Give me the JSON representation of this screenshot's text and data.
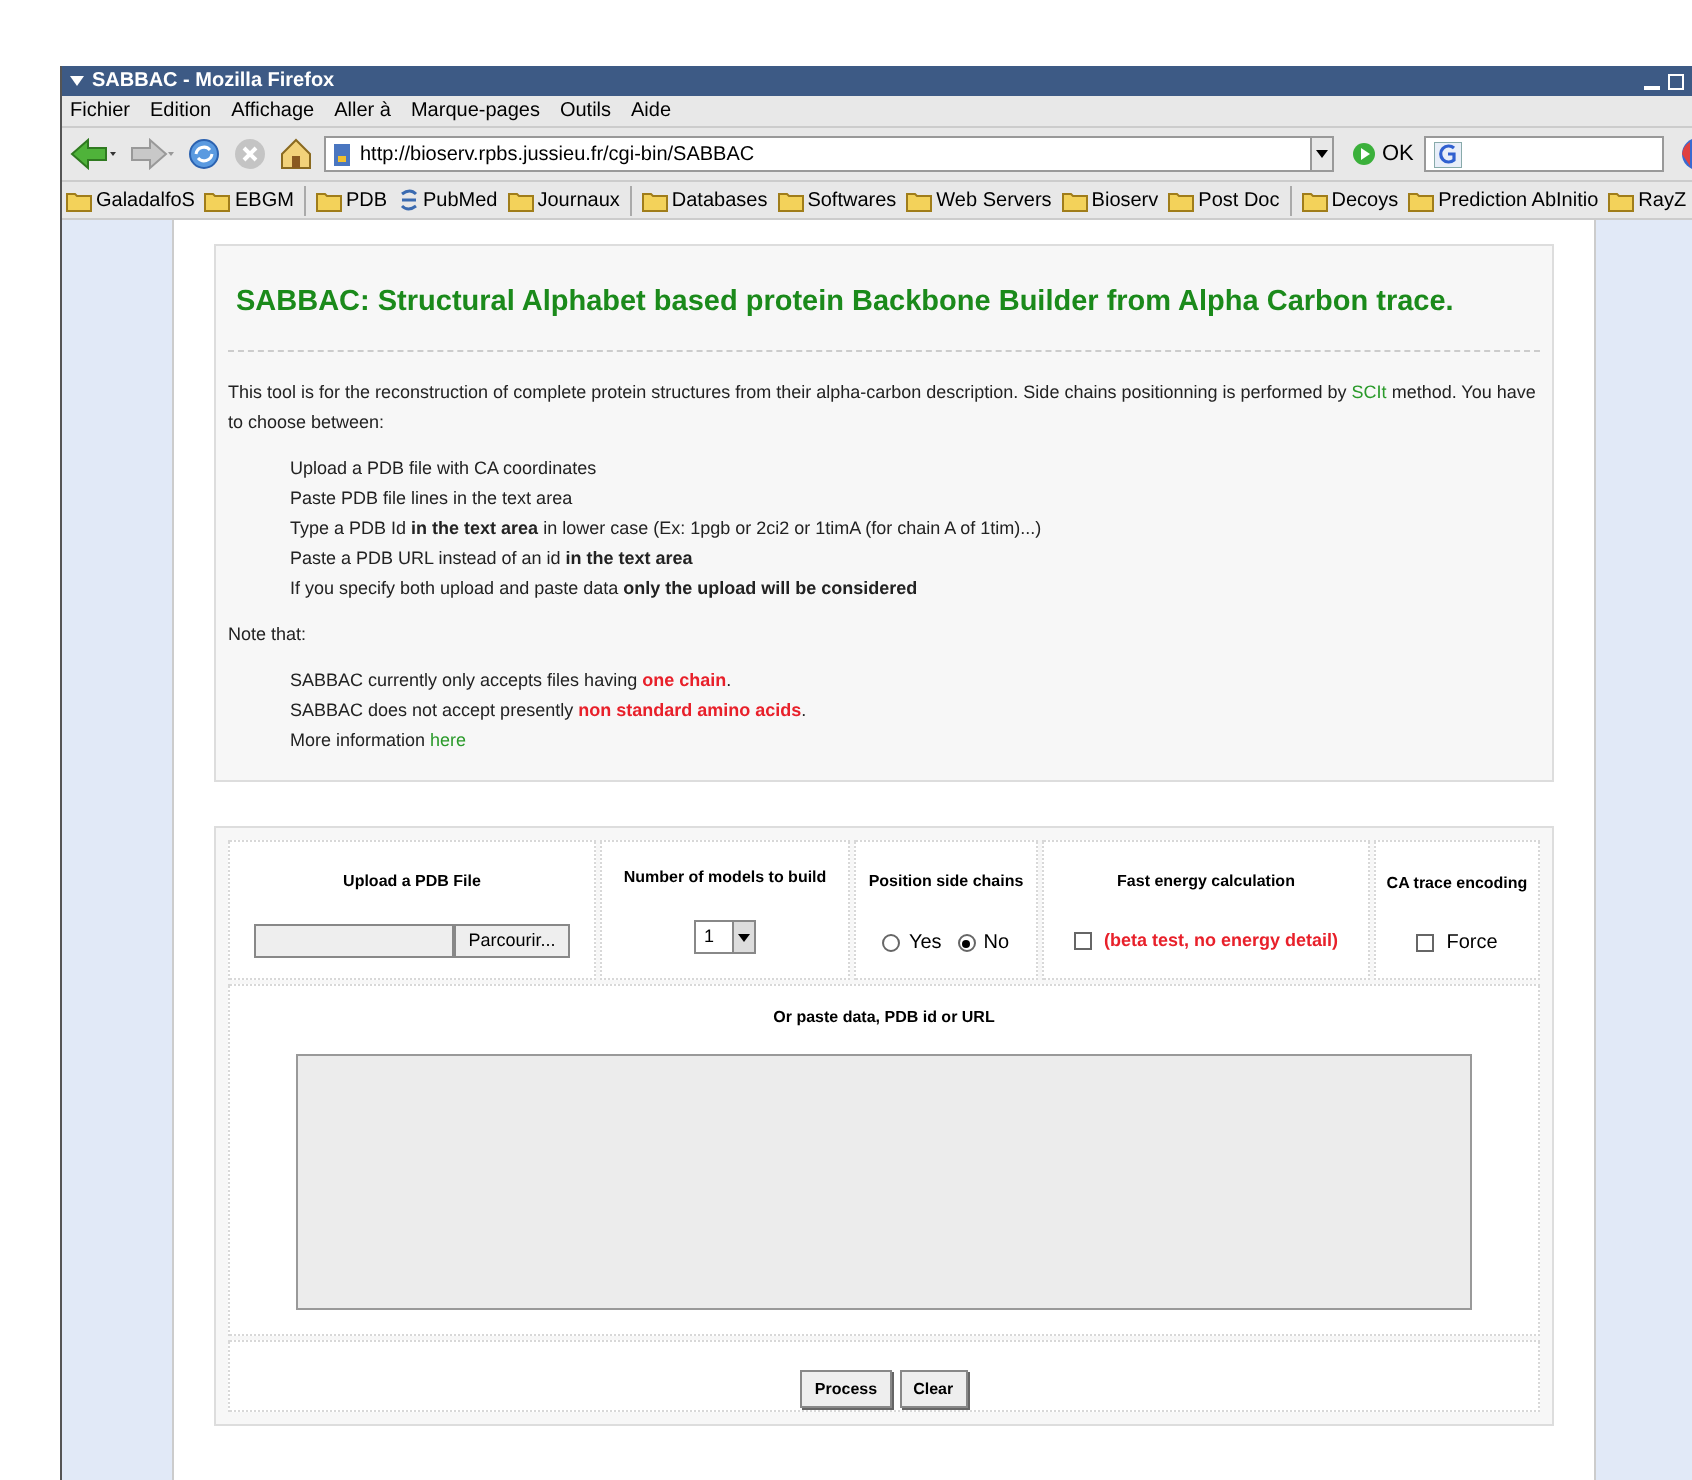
{
  "window": {
    "title": "SABBAC - Mozilla Firefox"
  },
  "menu": [
    "Fichier",
    "Edition",
    "Affichage",
    "Aller à",
    "Marque-pages",
    "Outils",
    "Aide"
  ],
  "toolbar": {
    "url": "http://bioserv.rpbs.jussieu.fr/cgi-bin/SABBAC",
    "go_label": "OK"
  },
  "bookmarks": [
    {
      "label": "GaladalfoS",
      "kind": "folder"
    },
    {
      "label": "EBGM",
      "kind": "folder"
    },
    {
      "kind": "separator"
    },
    {
      "label": "PDB",
      "kind": "folder"
    },
    {
      "label": "PubMed",
      "kind": "feed"
    },
    {
      "label": "Journaux",
      "kind": "folder"
    },
    {
      "kind": "separator"
    },
    {
      "label": "Databases",
      "kind": "folder"
    },
    {
      "label": "Softwares",
      "kind": "folder"
    },
    {
      "label": "Web Servers",
      "kind": "folder"
    },
    {
      "label": "Bioserv",
      "kind": "folder"
    },
    {
      "label": "Post Doc",
      "kind": "folder"
    },
    {
      "kind": "separator"
    },
    {
      "label": "Decoys",
      "kind": "folder"
    },
    {
      "label": "Prediction AbInitio",
      "kind": "folder"
    },
    {
      "label": "RayZ",
      "kind": "folder"
    }
  ],
  "page": {
    "heading": "SABBAC: Structural Alphabet based protein Backbone Builder from Alpha Carbon trace.",
    "intro": "This tool is for the reconstruction of complete protein structures from their alpha-carbon description. Side chains positionning is performed by",
    "intro_link": "SCIt",
    "intro_end": "method. You have to choose between:",
    "choices": [
      "Upload a PDB file with CA coordinates",
      "Paste PDB file lines in the text area",
      "Type a PDB Id **in the text area** in lower case (Ex:  1pgb or 2ci2 or 1timA (for chain A of 1tim)...)",
      "Paste a PDB URL instead of an id **in the text area**",
      "If you specify both upload and paste data **only the upload will be considered**"
    ],
    "note_label": "Note that:",
    "notes": [
      {
        "text": "SABBAC currently only accepts files having",
        "highlight": "one chain",
        "end": ".",
        "kind": "warning"
      },
      {
        "text": "SABBAC does not accept presently",
        "highlight": "non standard amino acids",
        "end": ".",
        "kind": "warning"
      },
      {
        "text": "More information",
        "highlight": "here",
        "kind": "link"
      }
    ]
  },
  "form": {
    "upload": {
      "label": "Upload a PDB File",
      "button": "Parcourir..."
    },
    "models": {
      "label": "Number of models to build",
      "value": "1"
    },
    "side_chains": {
      "label": "Position side chains",
      "options": [
        {
          "label": "Yes",
          "selected": false
        },
        {
          "label": "No",
          "selected": true
        }
      ]
    },
    "energy": {
      "label": "Fast energy calculation",
      "checked": false,
      "option": "(beta test, no energy detail)"
    },
    "ca_trace": {
      "label": "CA trace encoding",
      "checked": false,
      "option": "Force"
    },
    "paste_label": "Or paste data, PDB id or URL",
    "buttons": [
      "Process",
      "Clear"
    ]
  }
}
